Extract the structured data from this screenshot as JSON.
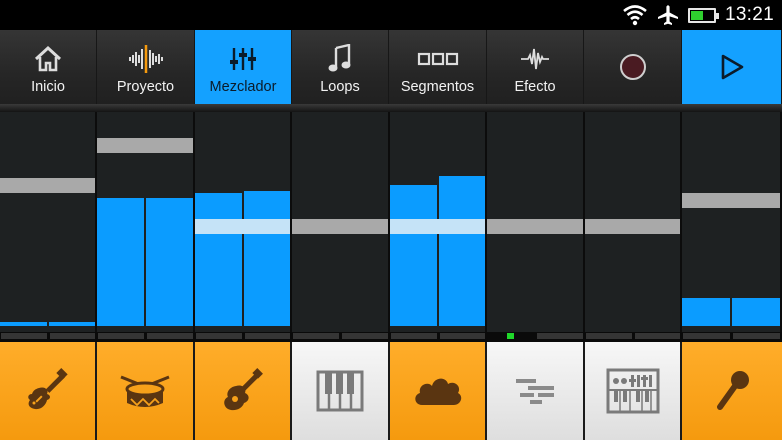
{
  "status_bar": {
    "time": "13:21",
    "icons": [
      "wifi-icon",
      "airplane-icon",
      "battery-icon"
    ],
    "battery_level": 0.55
  },
  "tabs": [
    {
      "label": "Inicio",
      "icon": "home-icon"
    },
    {
      "label": "Proyecto",
      "icon": "waveform-icon"
    },
    {
      "label": "Mezclador",
      "icon": "mixer-sliders-icon",
      "active": true
    },
    {
      "label": "Loops",
      "icon": "music-note-icon"
    },
    {
      "label": "Segmentos",
      "icon": "segments-icon"
    },
    {
      "label": "Efecto",
      "icon": "effect-wave-icon"
    }
  ],
  "transport": {
    "record_icon": "record-icon",
    "play_icon": "play-icon"
  },
  "colors": {
    "accent_blue": "#14a1ff",
    "meter_blue": "#0b9cff",
    "instrument_orange": "#f7a11a",
    "instrument_white": "#ececec",
    "active_meter_green": "#1fd72a"
  },
  "mixer": {
    "channels": [
      {
        "fader": 0.69,
        "levels": [
          0.02,
          0.02
        ],
        "fader_highlight": false
      },
      {
        "fader": 0.88,
        "levels": [
          0.6,
          0.6
        ],
        "fader_highlight": false
      },
      {
        "fader": 0.5,
        "levels": [
          0.62,
          0.63
        ],
        "fader_highlight": true
      },
      {
        "fader": 0.5,
        "levels": [
          0,
          0
        ],
        "fader_highlight": false
      },
      {
        "fader": 0.5,
        "levels": [
          0.66,
          0.7
        ],
        "fader_highlight": true
      },
      {
        "fader": 0.5,
        "levels": [
          0,
          0
        ],
        "fader_highlight": false
      },
      {
        "fader": 0.5,
        "levels": [
          0,
          0
        ],
        "fader_highlight": false
      },
      {
        "fader": 0.62,
        "levels": [
          0.13,
          0.13
        ],
        "fader_highlight": false
      }
    ],
    "active_meter_channel": 5
  },
  "instruments": [
    {
      "icon": "electric-guitar-icon",
      "style": "orange"
    },
    {
      "icon": "drum-icon",
      "style": "orange"
    },
    {
      "icon": "acoustic-guitar-icon",
      "style": "orange"
    },
    {
      "icon": "piano-keys-icon",
      "style": "white"
    },
    {
      "icon": "cloud-pad-icon",
      "style": "orange"
    },
    {
      "icon": "sequencer-bars-icon",
      "style": "white"
    },
    {
      "icon": "keyboard-synth-icon",
      "style": "white"
    },
    {
      "icon": "microphone-icon",
      "style": "orange"
    }
  ]
}
